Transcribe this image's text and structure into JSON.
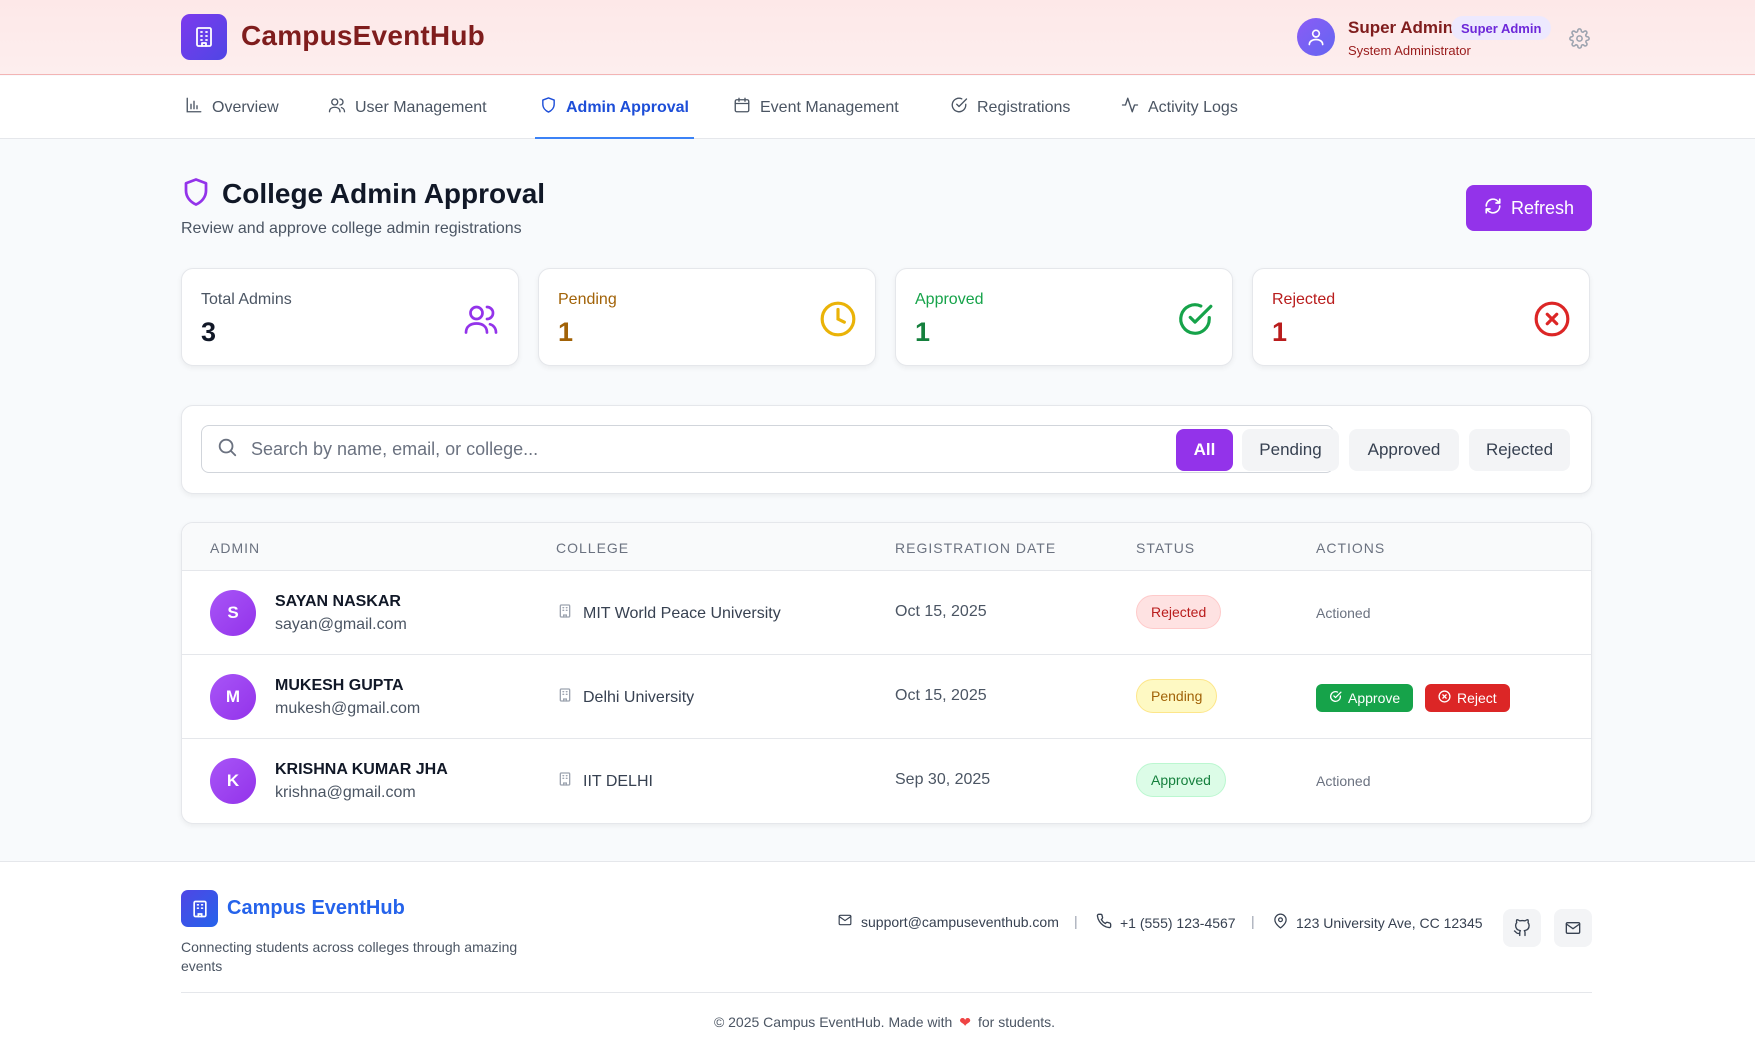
{
  "header": {
    "brand": "CampusEventHub",
    "user": {
      "name": "Super Admin",
      "badge": "Super Admin",
      "role": "System Administrator"
    }
  },
  "nav": {
    "items": [
      {
        "label": "Overview",
        "icon": "bar-chart-icon"
      },
      {
        "label": "User Management",
        "icon": "users-icon"
      },
      {
        "label": "Admin Approval",
        "icon": "shield-icon",
        "active": true
      },
      {
        "label": "Event Management",
        "icon": "calendar-icon"
      },
      {
        "label": "Registrations",
        "icon": "check-circle-icon"
      },
      {
        "label": "Activity Logs",
        "icon": "activity-icon"
      }
    ]
  },
  "page": {
    "title": "College Admin Approval",
    "subtitle": "Review and approve college admin registrations",
    "refresh_label": "Refresh"
  },
  "stats": [
    {
      "label": "Total Admins",
      "value": "3",
      "icon": "users-icon",
      "color": "#9333ea"
    },
    {
      "label": "Pending",
      "value": "1",
      "icon": "clock-icon",
      "color": "#ca8a04"
    },
    {
      "label": "Approved",
      "value": "1",
      "icon": "check-circle-icon",
      "color": "#16a34a"
    },
    {
      "label": "Rejected",
      "value": "1",
      "icon": "x-circle-icon",
      "color": "#dc2626"
    }
  ],
  "filters": {
    "search_placeholder": "Search by name, email, or college...",
    "search_value": "",
    "buttons": [
      "All",
      "Pending",
      "Approved",
      "Rejected"
    ],
    "active": "All"
  },
  "table": {
    "headers": [
      "ADMIN",
      "COLLEGE",
      "REGISTRATION DATE",
      "STATUS",
      "ACTIONS"
    ],
    "rows": [
      {
        "initial": "S",
        "name": "SAYAN NASKAR",
        "email": "sayan@gmail.com",
        "college": "MIT World Peace University",
        "date": "Oct 15, 2025",
        "status": "Rejected",
        "action": "Actioned"
      },
      {
        "initial": "M",
        "name": "MUKESH GUPTA",
        "email": "mukesh@gmail.com",
        "college": "Delhi University",
        "date": "Oct 15, 2025",
        "status": "Pending",
        "approve_label": "Approve",
        "reject_label": "Reject"
      },
      {
        "initial": "K",
        "name": "KRISHNA KUMAR JHA",
        "email": "krishna@gmail.com",
        "college": "IIT DELHI",
        "date": "Sep 30, 2025",
        "status": "Approved",
        "action": "Actioned"
      }
    ]
  },
  "footer": {
    "brand": "Campus EventHub",
    "tagline": "Connecting students across colleges through amazing events",
    "email": "support@campuseventhub.com",
    "phone": "+1 (555) 123-4567",
    "address": "123 University Ave, CC 12345",
    "separator": "|",
    "copyright_before": "© 2025 Campus EventHub. Made with",
    "copyright_after": "for students."
  },
  "colors": {
    "accent": "#9333ea",
    "nav_active": "#1d4ed8",
    "header_text": "#7f1d1d"
  }
}
